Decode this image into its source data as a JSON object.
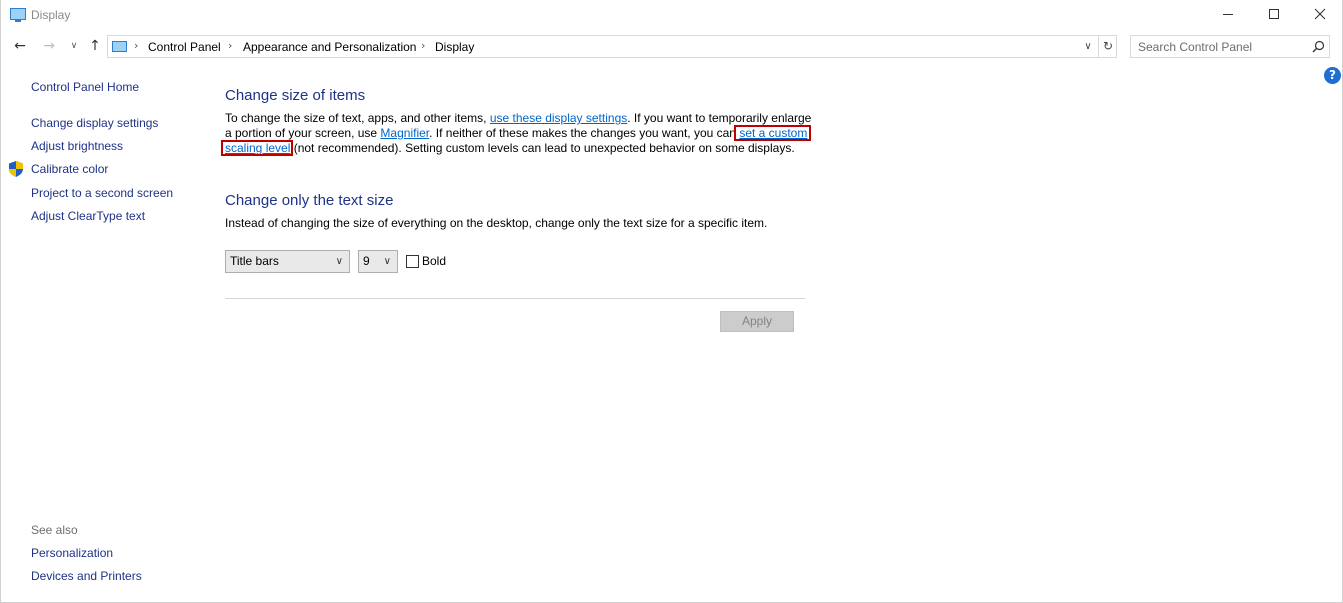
{
  "window": {
    "title": "Display",
    "icon": "display-monitor-icon",
    "controls": {
      "minimize": "minimize-icon",
      "maximize": "maximize-icon",
      "close": "close-icon"
    }
  },
  "navigation": {
    "back": "←",
    "forward": "→",
    "recent": "∨",
    "up": "↑"
  },
  "address": {
    "breadcrumbs": [
      "Control Panel",
      "Appearance and Personalization",
      "Display"
    ],
    "separator": "›",
    "dropdown": "∨",
    "refresh": "↻"
  },
  "search": {
    "placeholder": "Search Control Panel"
  },
  "help": {
    "label": "?"
  },
  "sidebar": {
    "home": "Control Panel Home",
    "items": [
      "Change display settings",
      "Adjust brightness",
      "Calibrate color",
      "Project to a second screen",
      "Adjust ClearType text"
    ],
    "see_also_label": "See also",
    "see_also": [
      "Personalization",
      "Devices and Printers"
    ]
  },
  "main": {
    "section1": {
      "title": "Change size of items",
      "text1": "To change the size of text, apps, and other items, ",
      "link1": "use these display settings",
      "text2": ".  If you want to temporarily enlarge a portion of your screen, use ",
      "link2": "Magnifier",
      "text3": ".  If neither of these makes the changes you want, you can ",
      "link3": "set a custom scaling level",
      "text4": " (not recommended).  Setting custom levels can lead to unexpected behavior on some displays."
    },
    "section2": {
      "title": "Change only the text size",
      "description": "Instead of changing the size of everything on the desktop, change only the text size for a specific item.",
      "item_select": "Title bars",
      "size_select": "9",
      "bold_label": "Bold",
      "bold_checked": false,
      "apply_label": "Apply"
    }
  },
  "colors": {
    "link": "#0066cc",
    "heading": "#1e3287",
    "highlight": "#c00000"
  }
}
